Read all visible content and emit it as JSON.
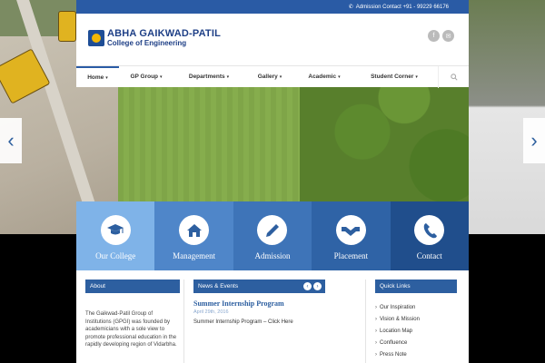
{
  "topbar": {
    "contact": "Admission Contact +91 - 99229 66176"
  },
  "logo": {
    "line1": "ABHA GAIKWAD-PATIL",
    "line2": "College of Engineering"
  },
  "social": [
    {
      "icon": "facebook-icon",
      "glyph": "f"
    },
    {
      "icon": "email-icon",
      "glyph": "✉"
    }
  ],
  "nav": [
    {
      "label": "Home",
      "active": true
    },
    {
      "label": "GP Group"
    },
    {
      "label": "Departments"
    },
    {
      "label": "Gallery"
    },
    {
      "label": "Academic"
    },
    {
      "label": "Student Corner"
    }
  ],
  "tiles": [
    {
      "label": "Our College",
      "icon": "graduation-cap-icon"
    },
    {
      "label": "Management",
      "icon": "home-icon"
    },
    {
      "label": "Admission",
      "icon": "pencil-icon"
    },
    {
      "label": "Placement",
      "icon": "handshake-icon"
    },
    {
      "label": "Contact",
      "icon": "phone-icon"
    }
  ],
  "about": {
    "heading": "About",
    "text": "The Gaikwad-Patil Group of Institutions (GPGI) was founded by academicians with a sole view to promote professional education in the rapidly developing region of Vidarbha."
  },
  "news": {
    "heading": "News & Events",
    "title": "Summer Internship Program",
    "date": "April 29th, 2016",
    "desc": "Summer Internship Program – Click Here"
  },
  "quick_links": {
    "heading": "Quick Links",
    "items": [
      "Our Inspiration",
      "Vision & Mission",
      "Location Map",
      "Confluence",
      "Press Note"
    ]
  },
  "colors": {
    "brand": "#2a5ba5",
    "tile_light": "#7fb3e8",
    "tile_dark": "#204e8c"
  }
}
